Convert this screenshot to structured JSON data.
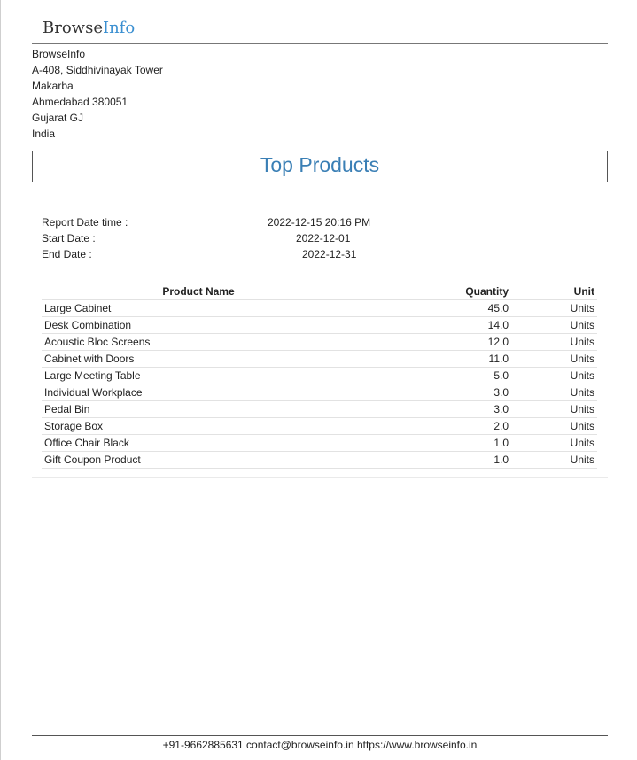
{
  "logo": {
    "part1": "Browse",
    "part2": "Info"
  },
  "company": {
    "lines": [
      "BrowseInfo",
      "A-408, Siddhivinayak Tower",
      "Makarba",
      "Ahmedabad 380051",
      "Gujarat GJ",
      "India"
    ]
  },
  "report": {
    "title": "Top Products",
    "meta": [
      {
        "label": "Report Date time :",
        "value": "2022-12-15 20:16 PM"
      },
      {
        "label": "Start Date :",
        "value": "2022-12-01"
      },
      {
        "label": "End Date :",
        "value": "2022-12-31"
      }
    ]
  },
  "table": {
    "headers": {
      "name": "Product Name",
      "quantity": "Quantity",
      "unit": "Unit"
    },
    "rows": [
      {
        "name": "Large Cabinet",
        "quantity": "45.0",
        "unit": "Units"
      },
      {
        "name": "Desk Combination",
        "quantity": "14.0",
        "unit": "Units"
      },
      {
        "name": "Acoustic Bloc Screens",
        "quantity": "12.0",
        "unit": "Units"
      },
      {
        "name": "Cabinet with Doors",
        "quantity": "11.0",
        "unit": "Units"
      },
      {
        "name": "Large Meeting Table",
        "quantity": "5.0",
        "unit": "Units"
      },
      {
        "name": "Individual Workplace",
        "quantity": "3.0",
        "unit": "Units"
      },
      {
        "name": "Pedal Bin",
        "quantity": "3.0",
        "unit": "Units"
      },
      {
        "name": "Storage Box",
        "quantity": "2.0",
        "unit": "Units"
      },
      {
        "name": "Office Chair Black",
        "quantity": "1.0",
        "unit": "Units"
      },
      {
        "name": "Gift Coupon Product",
        "quantity": "1.0",
        "unit": "Units"
      }
    ]
  },
  "footer": {
    "text": "+91-9662885631 contact@browseinfo.in https://www.browseinfo.in"
  },
  "colors": {
    "accent": "#3a7fb5",
    "logo_info": "#3a8fd1"
  }
}
